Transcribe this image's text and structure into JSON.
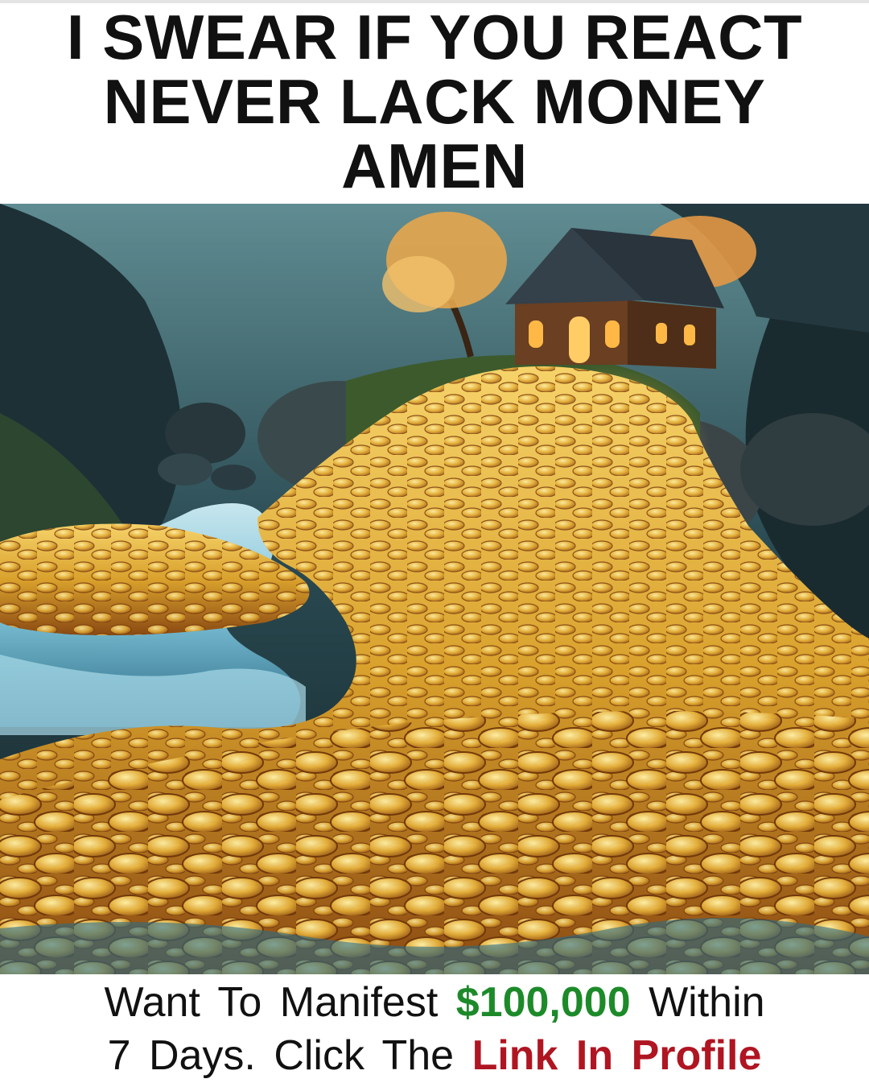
{
  "headline": {
    "line1": "I SWEAR IF YOU REACT",
    "line2": "NEVER LACK MONEY",
    "line3": "AMEN"
  },
  "artwork": {
    "subject": "house-on-river-of-gold-coins",
    "colors": {
      "sky": "#2a4a52",
      "mountain": "#1d3036",
      "water": "#7fc6dd",
      "gold": "#d9a12c",
      "gold_highlight": "#f6d36a",
      "coin_edge": "#8b4a12",
      "house_wall": "#6a3f22",
      "roof": "#34404a",
      "window_glow": "#ffb845",
      "tree_foliage": "#e6a64c"
    }
  },
  "caption": {
    "line1_prefix": "Want To Manifest",
    "amount": "$100,000",
    "line1_suffix": "Within",
    "line2_prefix": "7 Days. Click The",
    "link": "Link In Profile",
    "amount_color": "#1d8a2a",
    "link_color": "#b01522"
  }
}
